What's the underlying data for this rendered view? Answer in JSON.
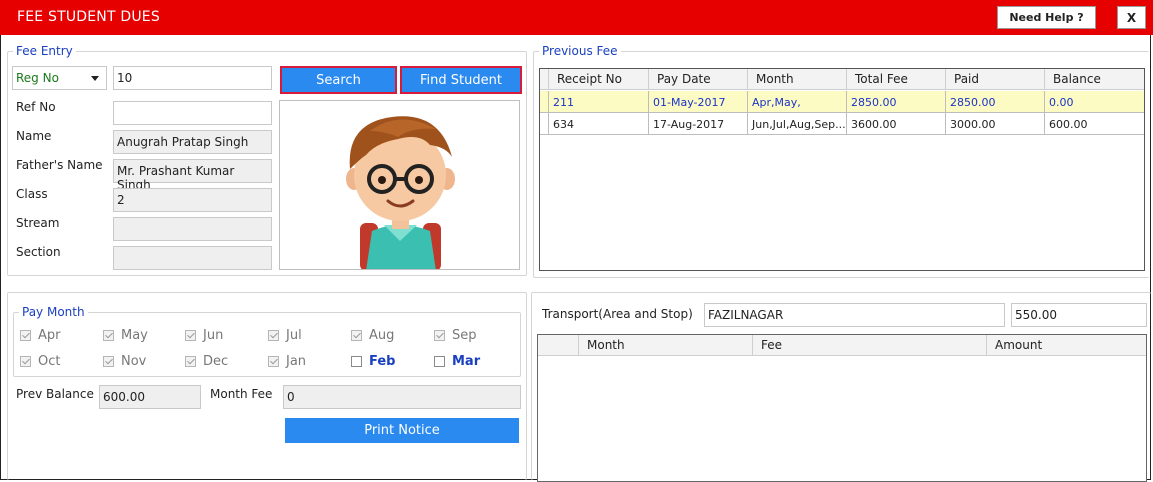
{
  "window": {
    "title": "FEE STUDENT DUES",
    "help_label": "Need Help ?",
    "close_label": "X"
  },
  "fee_entry": {
    "legend": "Fee Entry",
    "reg_select": "Reg No",
    "reg_value": "10",
    "search_label": "Search",
    "find_label": "Find Student",
    "fields": {
      "ref_no": {
        "label": "Ref No",
        "value": ""
      },
      "name": {
        "label": "Name",
        "value": "Anugrah Pratap Singh"
      },
      "father": {
        "label": "Father's Name",
        "value": "Mr. Prashant Kumar Singh"
      },
      "class": {
        "label": "Class",
        "value": "2"
      },
      "stream": {
        "label": "Stream",
        "value": ""
      },
      "section": {
        "label": "Section",
        "value": ""
      }
    }
  },
  "previous_fee": {
    "legend": "Previous Fee",
    "columns": [
      "Receipt No",
      "Pay Date",
      "Month",
      "Total Fee",
      "Paid",
      "Balance"
    ],
    "rows": [
      [
        "211",
        "01-May-2017",
        "Apr,May,",
        "2850.00",
        "2850.00",
        "0.00"
      ],
      [
        "634",
        "17-Aug-2017",
        "Jun,Jul,Aug,Sep...",
        "3600.00",
        "3000.00",
        "600.00"
      ]
    ]
  },
  "pay_month": {
    "legend": "Pay Month",
    "months": [
      {
        "label": "Apr",
        "checked": true
      },
      {
        "label": "May",
        "checked": true
      },
      {
        "label": "Jun",
        "checked": true
      },
      {
        "label": "Jul",
        "checked": true
      },
      {
        "label": "Aug",
        "checked": true
      },
      {
        "label": "Sep",
        "checked": true
      },
      {
        "label": "Oct",
        "checked": true
      },
      {
        "label": "Nov",
        "checked": true
      },
      {
        "label": "Dec",
        "checked": true
      },
      {
        "label": "Jan",
        "checked": true
      },
      {
        "label": "Feb",
        "checked": false
      },
      {
        "label": "Mar",
        "checked": false
      }
    ],
    "prev_balance_label": "Prev Balance",
    "prev_balance": "600.00",
    "month_fee_label": "Month Fee",
    "month_fee": "0",
    "print_label": "Print Notice"
  },
  "transport": {
    "label": "Transport(Area and Stop)",
    "area": "FAZILNAGAR",
    "amount": "550.00",
    "columns": [
      "Month",
      "Fee",
      "Amount"
    ]
  },
  "colors": {
    "title_bar": "#e60000",
    "button_blue": "#2a8af0",
    "legend_blue": "#1a3fbf",
    "selected_row": "#fdfbc4"
  }
}
